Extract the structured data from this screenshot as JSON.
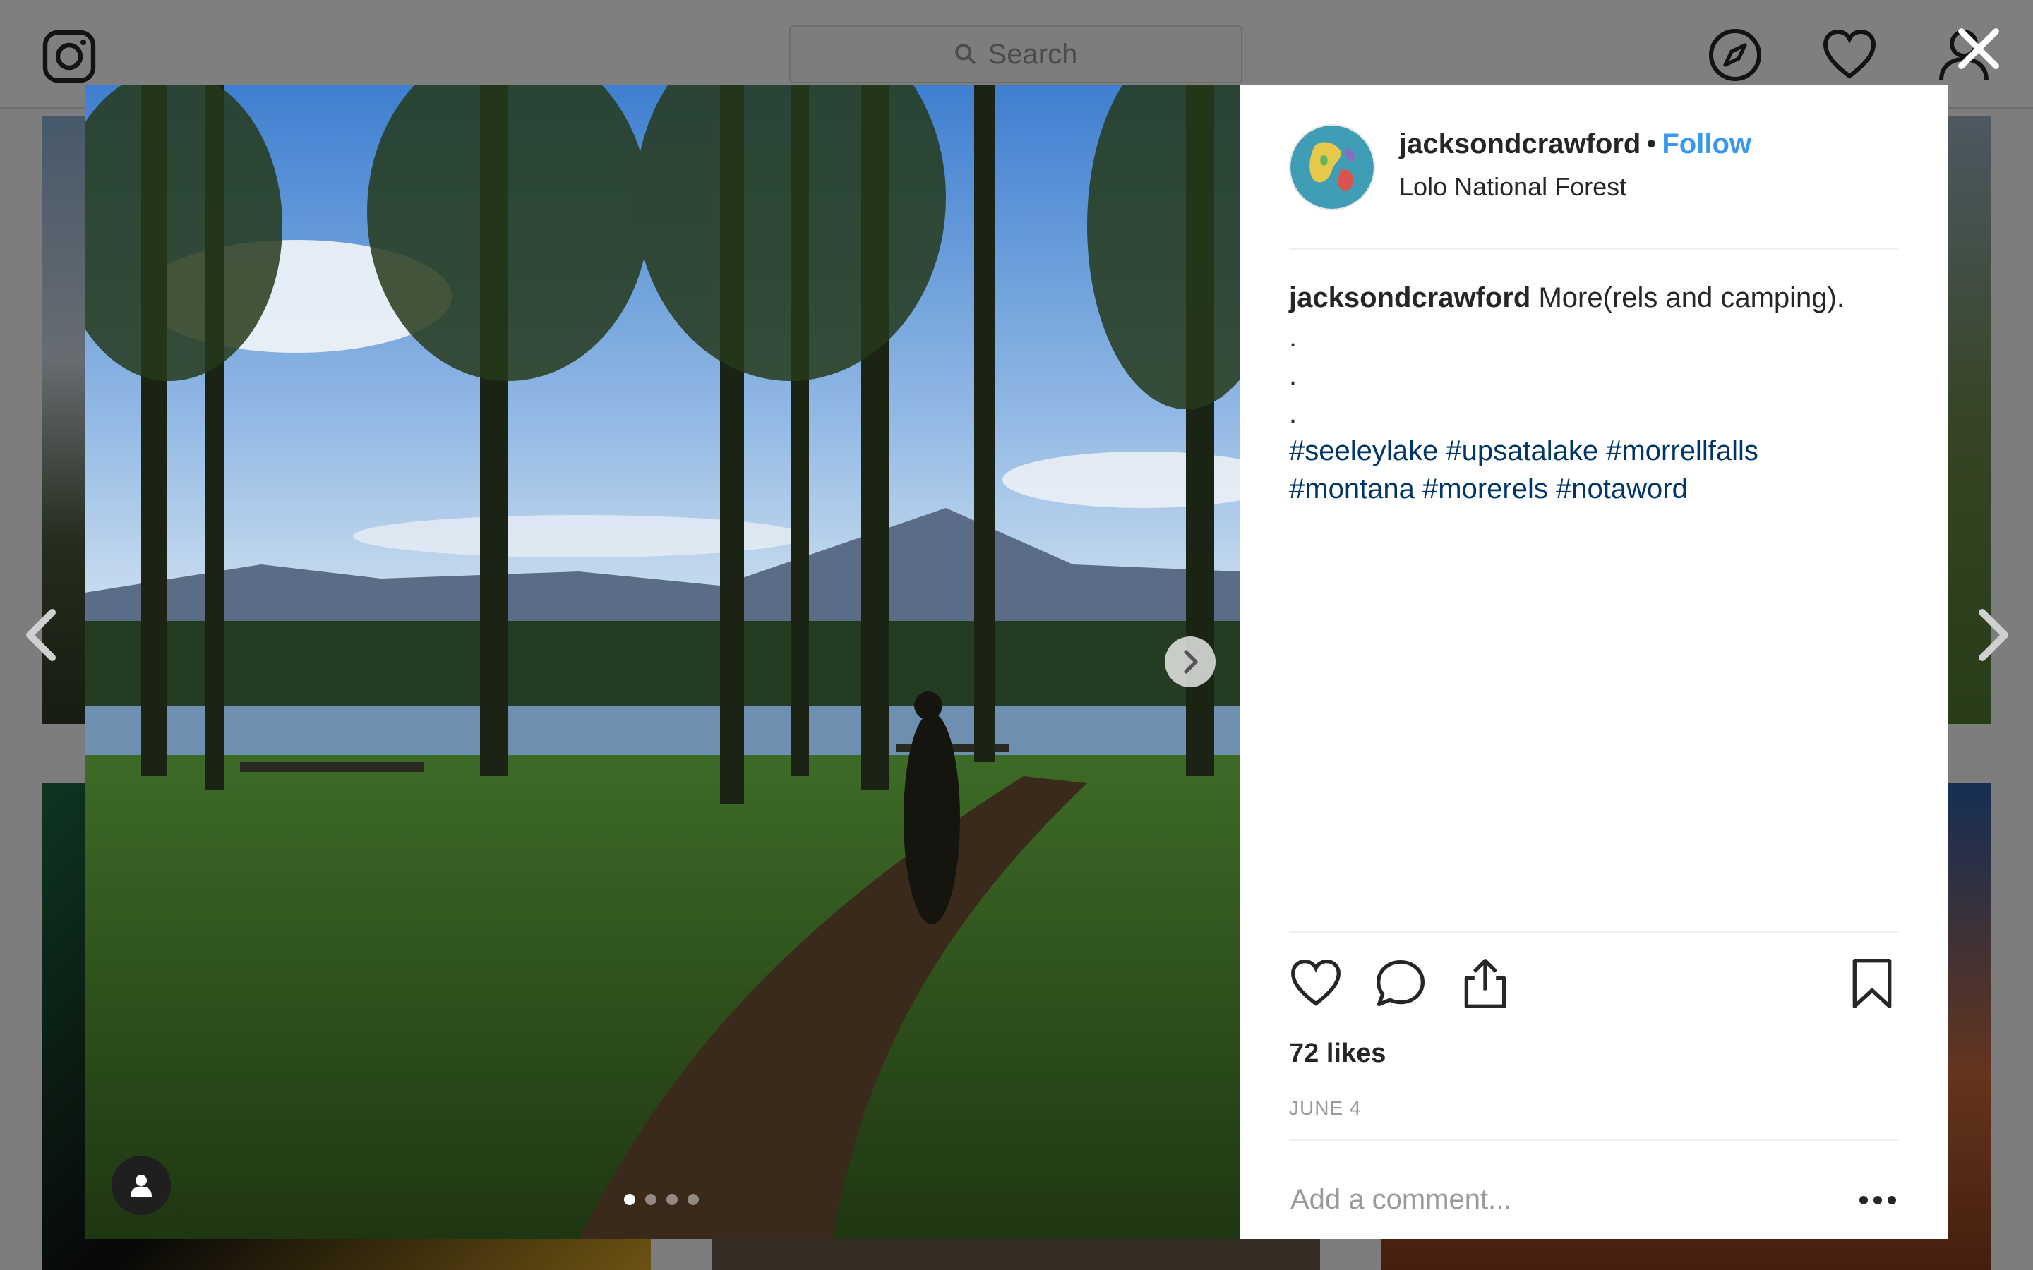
{
  "header": {
    "search_placeholder": "Search",
    "icons": [
      "instagram-icon",
      "search-icon",
      "explore-icon",
      "activity-heart-icon",
      "profile-icon"
    ]
  },
  "post": {
    "username": "jacksondcrawford",
    "separator": "•",
    "follow_label": "Follow",
    "location": "Lolo National Forest",
    "caption_text": "More(rels and camping).",
    "caption_dots": [
      ".",
      ".",
      "."
    ],
    "hashtags_line1": [
      "#seeleylake",
      "#upsatalake",
      "#morrellfalls"
    ],
    "hashtags_line2": [
      "#montana",
      "#morerels",
      "#notaword"
    ],
    "likes": "72 likes",
    "date": "JUNE 4",
    "comment_placeholder": "Add a comment...",
    "carousel": {
      "count": 4,
      "active_index": 0
    }
  },
  "colors": {
    "follow": "#3897f0",
    "hashtag": "#003569",
    "text": "#262626",
    "muted": "#999999",
    "divider": "#efefef"
  }
}
